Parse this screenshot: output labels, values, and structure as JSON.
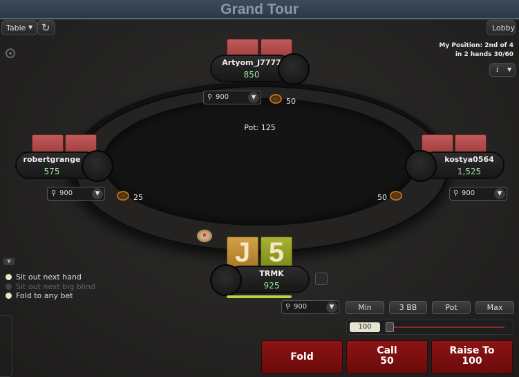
{
  "window": {
    "title": "Grand Tour"
  },
  "toolbar": {
    "table_menu": "Table",
    "lobby": "Lobby"
  },
  "tournament": {
    "position_line1": "My Position: 2nd of 4",
    "position_line2": "in 2 hands 30/60"
  },
  "pot": {
    "label": "Pot: 125"
  },
  "players": [
    {
      "name": "Artyom_J7777",
      "stack": "850",
      "note": "900",
      "bet": "50"
    },
    {
      "name": "robertgrange",
      "stack": "575",
      "note": "900",
      "bet": "25"
    },
    {
      "name": "kostya0564",
      "stack": "1,525",
      "note": "900",
      "bet": "50"
    },
    {
      "name": "TRMK",
      "stack": "925",
      "note": "900",
      "bet": ""
    }
  ],
  "hero_cards": [
    {
      "rank": "J",
      "color": "#c89a3a"
    },
    {
      "rank": "5",
      "color": "#9aaa2a"
    }
  ],
  "options": [
    {
      "label": "Sit out next hand",
      "enabled": true
    },
    {
      "label": "Sit out next big blind",
      "enabled": false
    },
    {
      "label": "Fold to any bet",
      "enabled": true
    }
  ],
  "bet_sizing": {
    "buttons": [
      "Min",
      "3 BB",
      "Pot",
      "Max"
    ],
    "amount": "100"
  },
  "actions": {
    "fold": "Fold",
    "call_label": "Call",
    "call_amount": "50",
    "raise_label": "Raise To",
    "raise_amount": "100"
  },
  "icons": {
    "refresh": "refresh-icon",
    "info": "info-icon",
    "target": "target-icon",
    "pin": "pin-icon",
    "dealer": "dealer-button-icon"
  },
  "colors": {
    "action_button": "#7a0f0f",
    "stack_text": "#9fe09f",
    "card_back": "#b44a4a"
  }
}
